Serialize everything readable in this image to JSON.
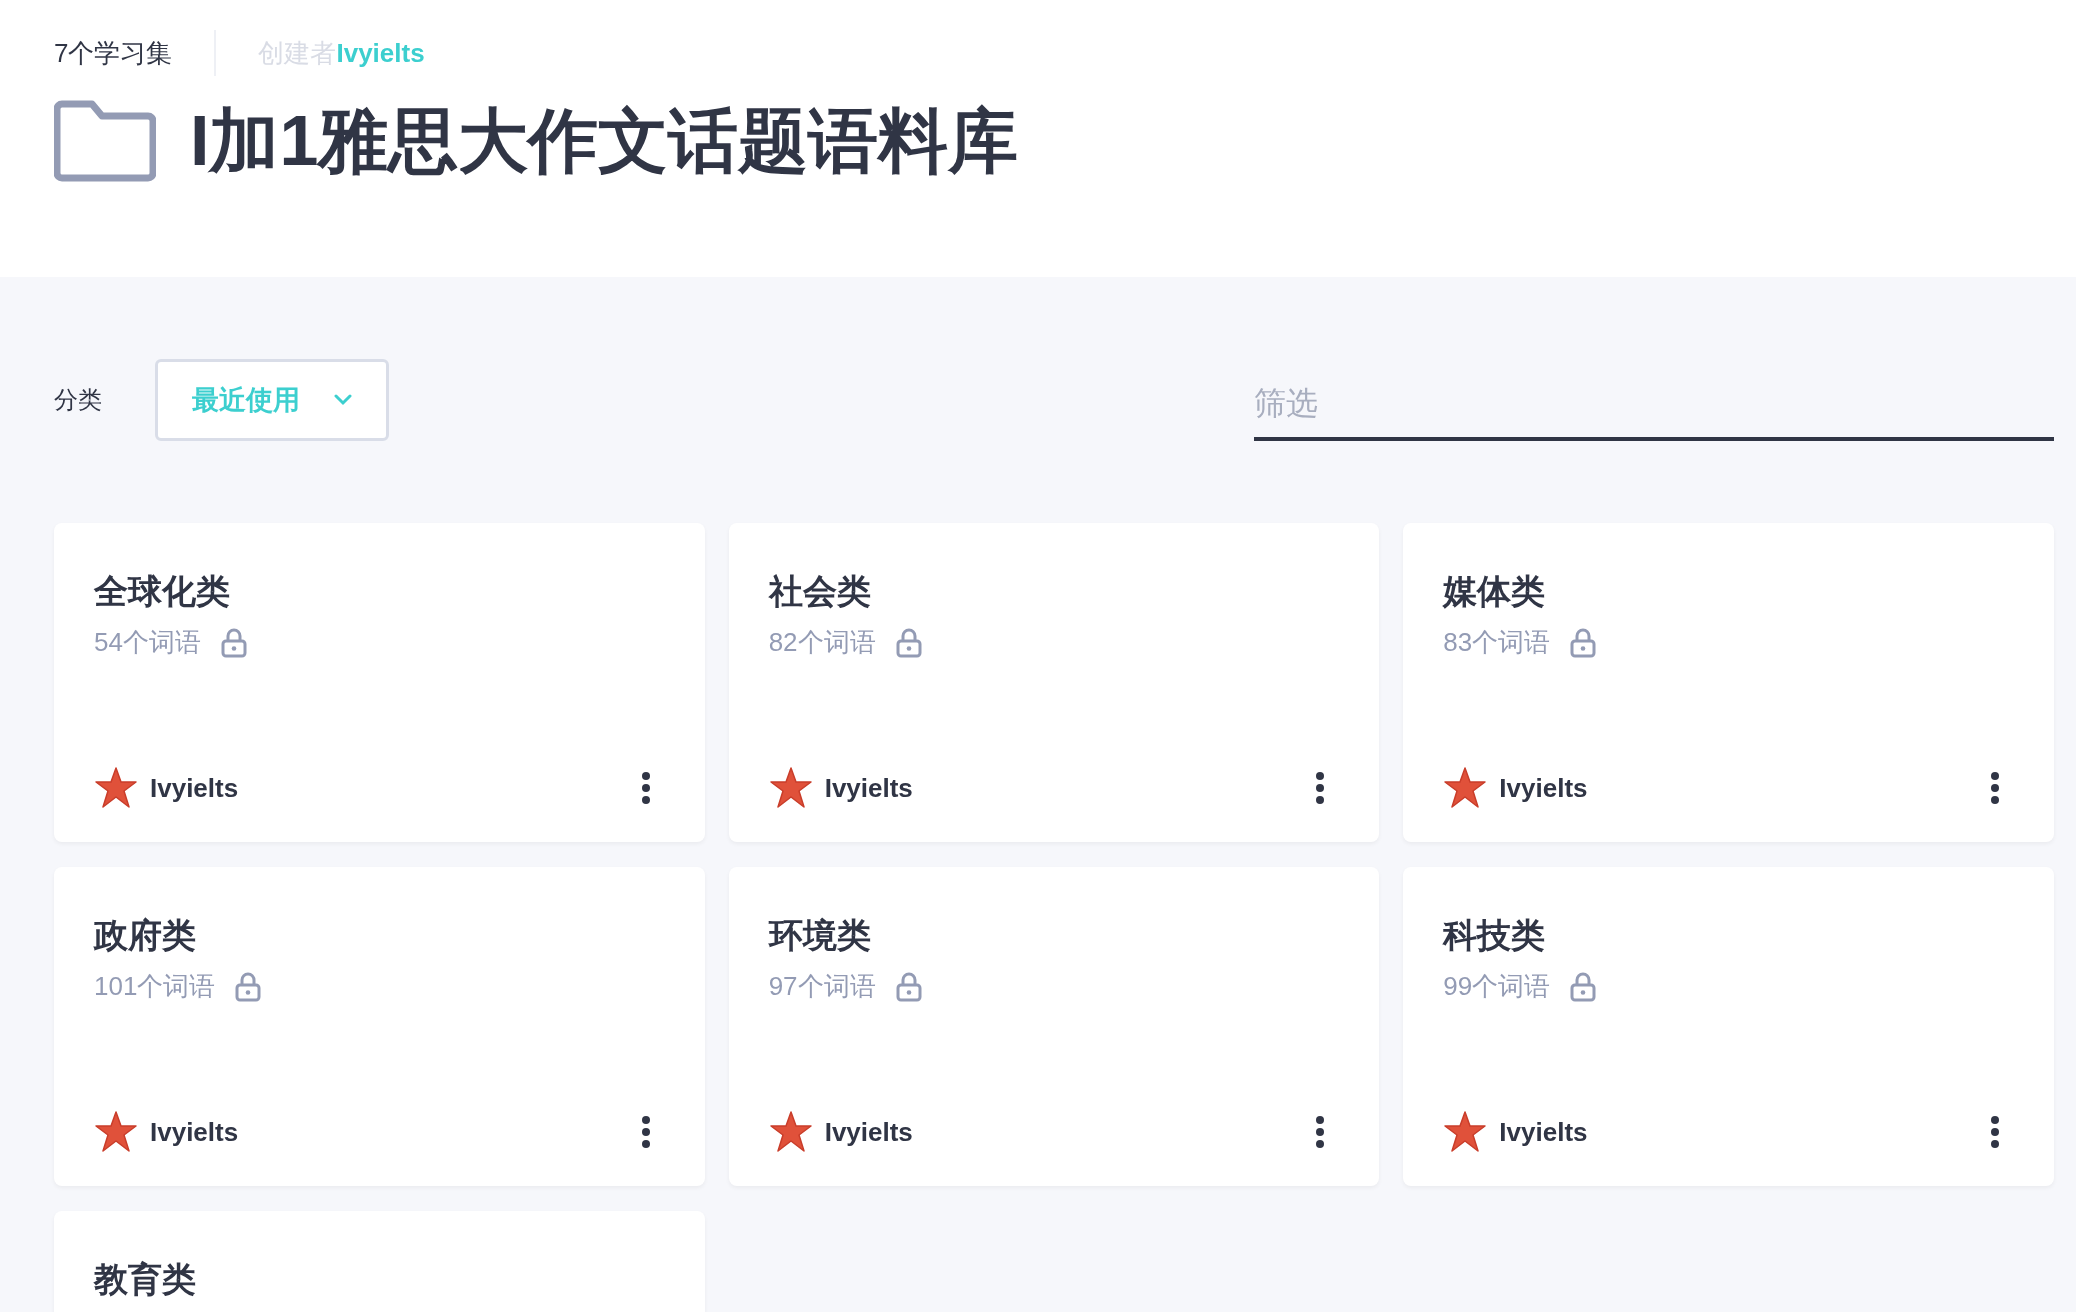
{
  "header": {
    "set_count": "7个学习集",
    "creator_label": "创建者",
    "creator_name": "Ivyielts",
    "title": "I加1雅思大作文话题语料库"
  },
  "toolbar": {
    "sort_label": "分类",
    "sort_value": "最近使用",
    "filter": {
      "placeholder": "筛选"
    }
  },
  "sets": [
    {
      "title": "全球化类",
      "term_count": "54个词语",
      "locked": true,
      "author": "Ivyielts"
    },
    {
      "title": "社会类",
      "term_count": "82个词语",
      "locked": true,
      "author": "Ivyielts"
    },
    {
      "title": "媒体类",
      "term_count": "83个词语",
      "locked": true,
      "author": "Ivyielts"
    },
    {
      "title": "政府类",
      "term_count": "101个词语",
      "locked": true,
      "author": "Ivyielts"
    },
    {
      "title": "环境类",
      "term_count": "97个词语",
      "locked": true,
      "author": "Ivyielts"
    },
    {
      "title": "科技类",
      "term_count": "99个词语",
      "locked": true,
      "author": "Ivyielts"
    },
    {
      "title": "教育类"
    }
  ]
}
